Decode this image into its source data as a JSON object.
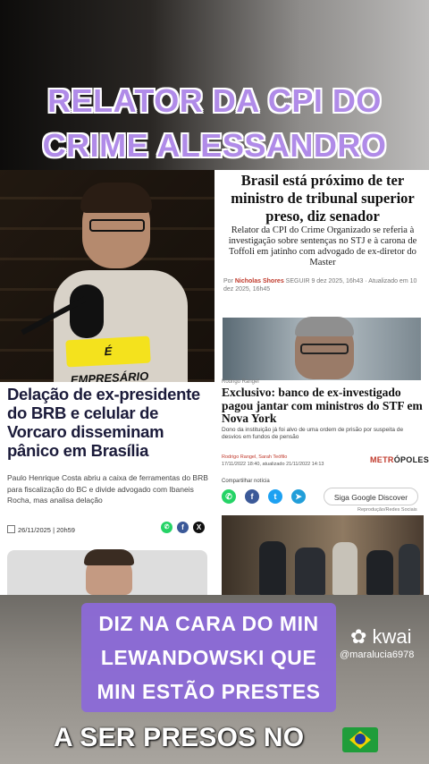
{
  "headline": {
    "line1": "RELATOR DA CPI DO",
    "line2": "CRIME ALESSANDRO"
  },
  "video": {
    "sticker": "É EMPRESÁRIO"
  },
  "article_right_top": {
    "title": "Brasil está próximo de ter ministro de tribunal superior preso, diz senador",
    "subtitle": "Relator da CPI do Crime Organizado se referia à investigação sobre sentenças no STJ e à carona de Toffoli em jatinho com advogado de ex-diretor do Master",
    "byline_prefix": "Por",
    "author": "Nicholas Shores",
    "byline_rest": "SEGUIR 9 dez 2025, 16h43 · Atualizado em 10 dez 2025, 16h45"
  },
  "article_right_bottom": {
    "label": "Rodrigo Rangel",
    "title": "Exclusivo: banco de ex-investigado pagou jantar com ministros do STF em Nova York",
    "subtitle": "Dono da instituição já foi alvo de uma ordem de prisão por suspeita de desvios em fundos de pensão",
    "authors": "Rodrigo Rangel, Sarah Teófilo",
    "date": "17/11/2022 18:40, atualizado 21/11/2022 14:13",
    "publisher_prefix": "METR",
    "publisher_rest": "ÓPOLES",
    "share_label": "Compartilhar notícia",
    "google_pill": "Siga  Google Discover",
    "repro": "Reprodução/Redes Sociais"
  },
  "article_left": {
    "title": "Delação de ex-presidente do BRB e celular de Vorcaro disseminam pânico em Brasília",
    "subtitle": "Paulo Henrique Costa abriu a caixa de ferramentas do BRB para fiscalização do BC e divide advogado com Ibaneis Rocha, mas analisa delação",
    "date": "26/11/2025 | 20h59"
  },
  "caption": {
    "line1": "DIZ NA CARA DO MIN",
    "line2": "LEWANDOWSKI QUE",
    "line3": "MIN ESTÃO PRESTES",
    "line4": "A SER PRESOS NO"
  },
  "watermark": {
    "logo": "kwai",
    "user": "@maralucia6978"
  },
  "colors": {
    "headline": "#b08be8",
    "caption_box": "#8b6ad6",
    "sticker": "#f4e21d",
    "author_red": "#c0392b"
  }
}
